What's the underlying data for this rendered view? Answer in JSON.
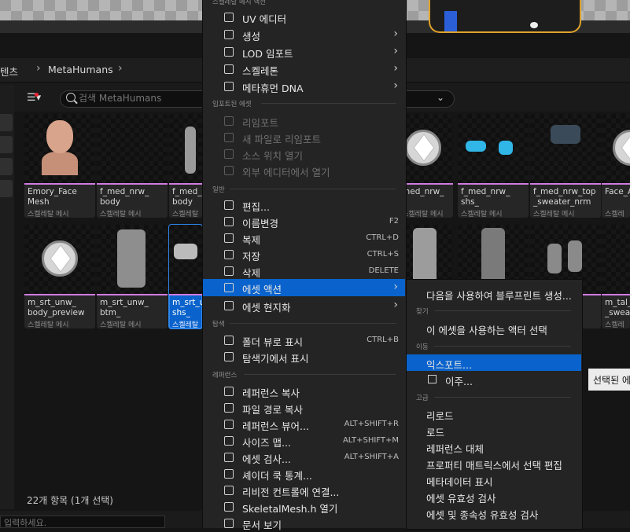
{
  "breadcrumb": {
    "parent": "텐츠",
    "current": "MetaHumans"
  },
  "search": {
    "placeholder": "검색 MetaHumans"
  },
  "assets": [
    {
      "name": "Emory_Face\nMesh",
      "type": "스켈레탈 메시"
    },
    {
      "name": "f_med_nrw_\nbody",
      "type": "스켈레탈 메시"
    },
    {
      "name": "f_med_n\nbody",
      "type": "스켈레탈 메시"
    },
    {
      "name": "med_nrw_",
      "type": "스켈레탈 메시"
    },
    {
      "name": "f_med_nrw_\nshs_",
      "type": "스켈레탈 메시"
    },
    {
      "name": "f_med_nrw_top\n_sweater_nrm",
      "type": "스켈레탈 메시"
    },
    {
      "name": "Face_A",
      "type": "스켈레탈"
    },
    {
      "name": "m_srt_unw_\nbody_preview",
      "type": "스켈레탈 메시"
    },
    {
      "name": "m_srt_unw_\nbtm_",
      "type": "스켈레탈 메시"
    },
    {
      "name": "m_srt_u\nshs_",
      "type": "스켈레탈 메"
    },
    {
      "name": "m_tal_\n_sweat",
      "type": "스켈레탈"
    }
  ],
  "status": {
    "count": "22개 항목 (1개 선택)"
  },
  "command_placeholder": "입력하세요.",
  "menu": {
    "header_top": "스켈레탈 메시 액션",
    "items_top": [
      {
        "label": "UV 에디터"
      },
      {
        "label": "생성"
      },
      {
        "label": "LOD 임포트"
      },
      {
        "label": "스켈레톤"
      },
      {
        "label": "메타휴먼 DNA"
      }
    ],
    "sec_import": "임포트된 에셋",
    "items_import": [
      {
        "label": "리임포트"
      },
      {
        "label": "새 파일로 리임포트"
      },
      {
        "label": "소스 위치 열기"
      },
      {
        "label": "외부 에디터에서 열기"
      }
    ],
    "sec_general": "일반",
    "items_general": [
      {
        "label": "편집...",
        "shortcut": ""
      },
      {
        "label": "이름변경",
        "shortcut": "F2"
      },
      {
        "label": "복제",
        "shortcut": "CTRL+D"
      },
      {
        "label": "저장",
        "shortcut": "CTRL+S"
      },
      {
        "label": "삭제",
        "shortcut": "DELETE"
      },
      {
        "label": "에셋 액션",
        "shortcut": ""
      },
      {
        "label": "에셋 현지화",
        "shortcut": ""
      }
    ],
    "sec_explore": "탐색",
    "items_explore": [
      {
        "label": "폴더 뷰로 표시",
        "shortcut": "CTRL+B"
      },
      {
        "label": "탐색기에서 표시",
        "shortcut": ""
      }
    ],
    "sec_reference": "레퍼런스",
    "items_reference": [
      {
        "label": "레퍼런스 복사",
        "shortcut": ""
      },
      {
        "label": "파일 경로 복사",
        "shortcut": ""
      },
      {
        "label": "레퍼런스 뷰어...",
        "shortcut": "ALT+SHIFT+R"
      },
      {
        "label": "사이즈 맵...",
        "shortcut": "ALT+SHIFT+M"
      },
      {
        "label": "에셋 검사...",
        "shortcut": "ALT+SHIFT+A"
      },
      {
        "label": "셰이더 쿡 통계...",
        "shortcut": ""
      },
      {
        "label": "리비전 컨트롤에 연결...",
        "shortcut": ""
      },
      {
        "label": "SkeletalMesh.h 열기",
        "shortcut": ""
      },
      {
        "label": "문서 보기",
        "shortcut": ""
      }
    ]
  },
  "submenu": {
    "item_blueprint": "다음을 사용하여 블루프린트 생성...",
    "sec_find": "찾기",
    "item_select_actor": "이 에셋을 사용하는 액터 선택",
    "sec_move": "이동",
    "item_export": "익스포트...",
    "item_migrate": "이주...",
    "sec_advanced": "고급",
    "items_advanced": [
      "리로드",
      "로드",
      "레퍼런스 대체",
      "프로퍼티 매트릭스에서 선택 편집",
      "메타데이터 표시",
      "에셋 유효성 검사",
      "에셋 및 종속성 유효성 검사"
    ]
  },
  "tooltip": "선택된 에"
}
